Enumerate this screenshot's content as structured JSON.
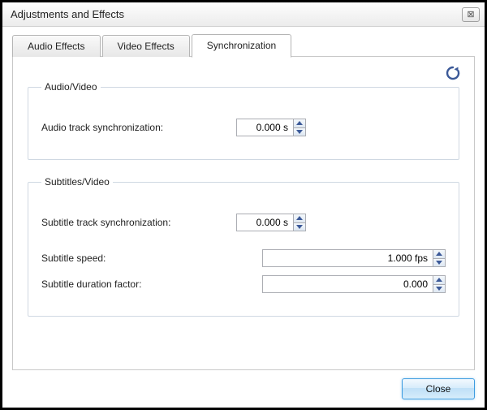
{
  "window": {
    "title": "Adjustments and Effects",
    "close_glyph": "⊠"
  },
  "tabs": {
    "audio_effects": "Audio Effects",
    "video_effects": "Video Effects",
    "synchronization": "Synchronization"
  },
  "sync": {
    "group_av": "Audio/Video",
    "audio_track_label": "Audio track synchronization:",
    "audio_track_value": "0.000 s",
    "group_sub": "Subtitles/Video",
    "subtitle_track_label": "Subtitle track synchronization:",
    "subtitle_track_value": "0.000 s",
    "subtitle_speed_label": "Subtitle speed:",
    "subtitle_speed_value": "1.000 fps",
    "subtitle_duration_label": "Subtitle duration factor:",
    "subtitle_duration_value": "0.000"
  },
  "buttons": {
    "close": "Close"
  },
  "icons": {
    "refresh": "refresh-icon"
  },
  "colors": {
    "accent": "#3c9be0",
    "refresh": "#3b5998"
  }
}
